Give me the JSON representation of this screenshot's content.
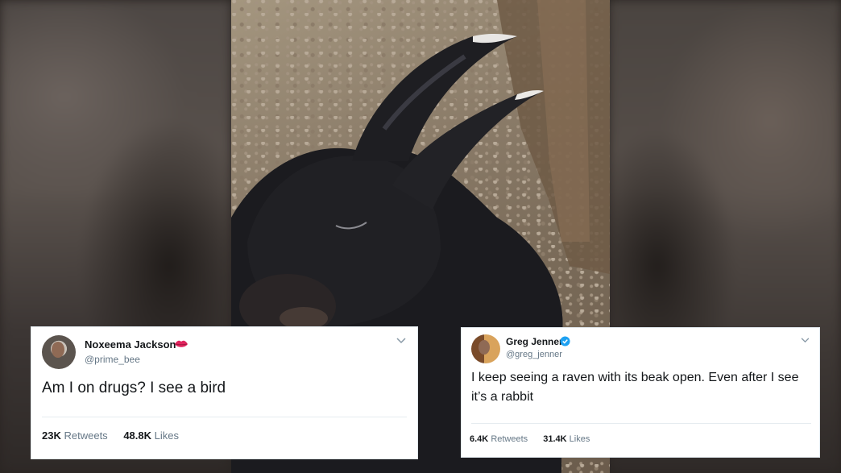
{
  "tweets": [
    {
      "name": "Noxeema Jackson",
      "handle": "@prime_bee",
      "badge_icon": "red-lips-emoji",
      "text": "Am I on drugs? I see a bird",
      "retweets_count": "23K",
      "retweets_label": "Retweets",
      "likes_count": "48.8K",
      "likes_label": "Likes"
    },
    {
      "name": "Greg Jenner",
      "handle": "@greg_jenner",
      "badge_icon": "verified-badge",
      "text": "I keep seeing a raven with its beak open. Even after I see it’s a rabbit",
      "retweets_count": "6.4K",
      "retweets_label": "Retweets",
      "likes_count": "31.4K",
      "likes_label": "Likes"
    }
  ],
  "icons": {
    "menu": "chevron-down-icon"
  },
  "colors": {
    "verified": "#1da1f2",
    "lips": "#e0245e"
  }
}
